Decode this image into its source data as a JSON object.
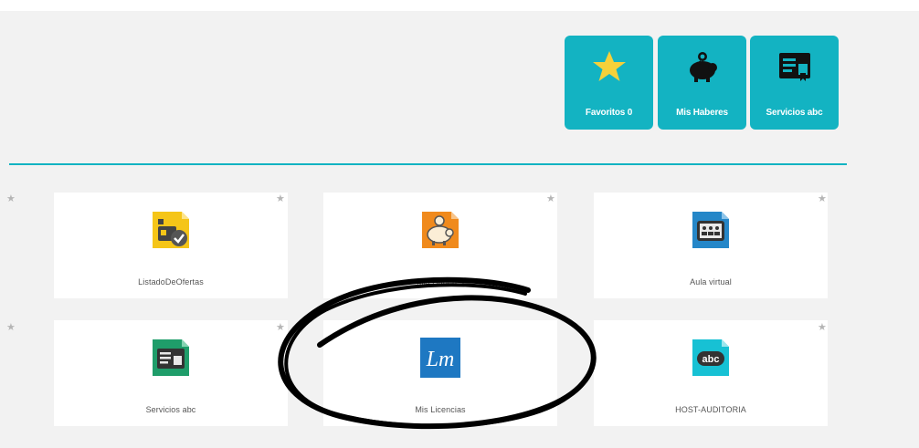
{
  "quick_access": [
    {
      "label": "Favoritos 0",
      "icon": "star-icon"
    },
    {
      "label": "Mis Haberes",
      "icon": "piggy-bank-icon"
    },
    {
      "label": "Servicios abc",
      "icon": "service-card-icon"
    }
  ],
  "cards": [
    {
      "label": "ListadoDeOfertas",
      "icon": "id-badge-check-icon"
    },
    {
      "label": "Mis Haberes",
      "icon": "piggy-bank-icon"
    },
    {
      "label": "Aula virtual",
      "icon": "classroom-icon"
    },
    {
      "label": "Servicios abc",
      "icon": "service-card-icon"
    },
    {
      "label": "Mis Licencias",
      "icon": "lm-logo-icon",
      "logo_text": "Lm"
    },
    {
      "label": "HOST-AUDITORIA",
      "icon": "abc-badge-icon",
      "logo_text": "abc"
    }
  ],
  "colors": {
    "accent": "#13b3c2",
    "panel_bg": "#f2f2f2",
    "star": "#f5d13a"
  }
}
